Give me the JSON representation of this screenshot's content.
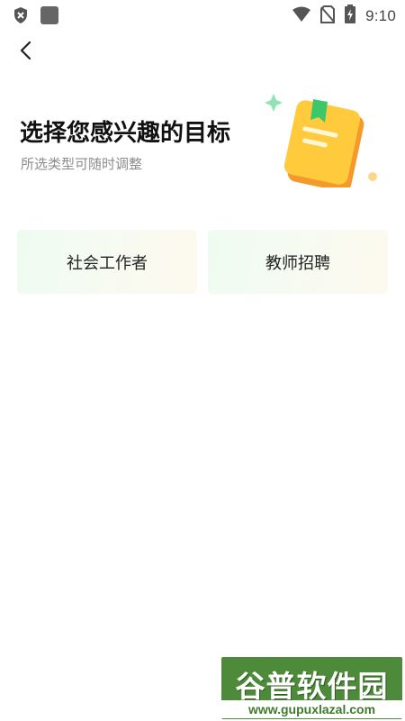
{
  "status_bar": {
    "time": "9:10",
    "icons": [
      "shield-icon",
      "app-square-icon",
      "wifi-icon",
      "no-sim-icon",
      "battery-charging-icon"
    ]
  },
  "header": {
    "back_icon": "chevron-left-icon"
  },
  "main": {
    "title": "选择您感兴趣的目标",
    "subtitle": "所选类型可随时调整",
    "illustration_icon": "book-bookmark-icon",
    "options": [
      {
        "label": "社会工作者"
      },
      {
        "label": "教师招聘"
      }
    ]
  },
  "watermark": {
    "title": "谷普软件园",
    "url": "www.gupuxlazal.com"
  },
  "colors": {
    "option_gradient_start": "#eefbf1",
    "option_gradient_end": "#fdf9ee",
    "book_yellow": "#ffcb3d",
    "bookmark_green": "#3cc86a",
    "watermark_green": "#4d8a3a"
  }
}
